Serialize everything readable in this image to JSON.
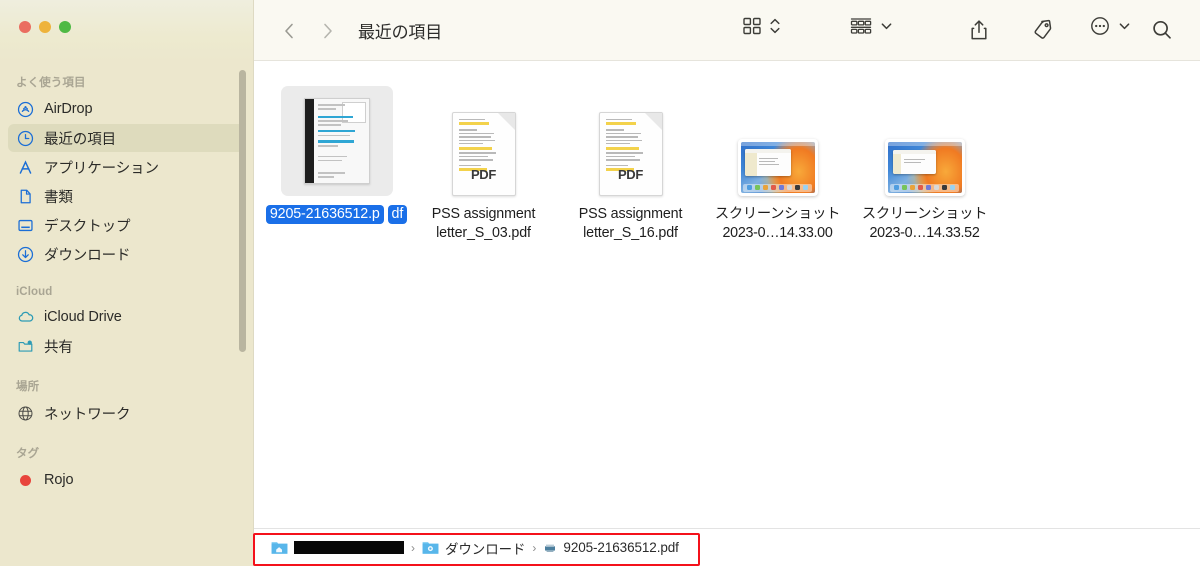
{
  "window": {
    "title": "最近の項目",
    "traffic_lights": [
      "close",
      "minimize",
      "zoom"
    ],
    "colors": {
      "sidebar_bg": "#ece7cd",
      "toolbar_bg": "#faf9f2",
      "selection_blue": "#1a6fe8",
      "annotation_red": "#f4111b",
      "sidebar_selected": "#dedbbd",
      "icon_blue": "#1b6ed6"
    }
  },
  "toolbar": {
    "back_label": "戻る",
    "forward_label": "進む",
    "title": "最近の項目",
    "buttons": [
      {
        "name": "icon-view",
        "label": "アイコン表示",
        "icon": "grid-icon"
      },
      {
        "name": "view-stepper",
        "label": "表示切り替え",
        "icon": "chevron-updown-icon"
      },
      {
        "name": "group-by",
        "label": "グループ分け",
        "icon": "group-rows-icon"
      },
      {
        "name": "group-by-chevron",
        "label": "グループメニュー",
        "icon": "chevron-down-icon"
      },
      {
        "name": "share",
        "label": "共有",
        "icon": "share-icon"
      },
      {
        "name": "tag",
        "label": "タグ",
        "icon": "tag-icon"
      },
      {
        "name": "more",
        "label": "その他",
        "icon": "ellipsis-circle-icon"
      },
      {
        "name": "more-chevron",
        "label": "その他メニュー",
        "icon": "chevron-down-icon"
      },
      {
        "name": "search",
        "label": "検索",
        "icon": "search-icon"
      }
    ]
  },
  "sidebar": {
    "groups": [
      {
        "title": "よく使う項目",
        "items": [
          {
            "label": "AirDrop",
            "icon": "airdrop-icon",
            "selected": false
          },
          {
            "label": "最近の項目",
            "icon": "clock-icon",
            "selected": true
          },
          {
            "label": "アプリケーション",
            "icon": "applications-icon",
            "selected": false
          },
          {
            "label": "書類",
            "icon": "document-icon",
            "selected": false
          },
          {
            "label": "デスクトップ",
            "icon": "desktop-icon",
            "selected": false
          },
          {
            "label": "ダウンロード",
            "icon": "download-icon",
            "selected": false
          }
        ]
      },
      {
        "title": "iCloud",
        "items": [
          {
            "label": "iCloud Drive",
            "icon": "cloud-icon",
            "selected": false
          },
          {
            "label": "共有",
            "icon": "shared-folder-icon",
            "selected": false
          }
        ]
      },
      {
        "title": "場所",
        "items": [
          {
            "label": "ネットワーク",
            "icon": "globe-icon",
            "selected": false
          }
        ]
      },
      {
        "title": "タグ",
        "items": [
          {
            "label": "Rojo",
            "icon": "tag-dot-red",
            "selected": false
          }
        ]
      }
    ]
  },
  "files": [
    {
      "name_lines": [
        "9205-21636512.p",
        "df"
      ],
      "full_name": "9205-21636512.pdf",
      "kind": "pdf-preview",
      "selected": true
    },
    {
      "name_lines": [
        "PSS assignment",
        "letter_S_03.pdf"
      ],
      "full_name": "PSS assignment letter_S_03.pdf",
      "kind": "pdf-icon",
      "badge": "PDF",
      "selected": false
    },
    {
      "name_lines": [
        "PSS assignment",
        "letter_S_16.pdf"
      ],
      "full_name": "PSS assignment letter_S_16.pdf",
      "kind": "pdf-icon",
      "badge": "PDF",
      "selected": false
    },
    {
      "name_lines": [
        "スクリーンショット",
        "2023-0…14.33.00"
      ],
      "full_name": "スクリーンショット 2023-0…14.33.00",
      "kind": "screenshot",
      "selected": false
    },
    {
      "name_lines": [
        "スクリーンショット",
        "2023-0…14.33.52"
      ],
      "full_name": "スクリーンショット 2023-0…14.33.52",
      "kind": "screenshot",
      "selected": false
    }
  ],
  "path_bar": {
    "highlighted": true,
    "crumbs": [
      {
        "label": "",
        "icon": "home-folder-icon",
        "redacted": true
      },
      {
        "label": "ダウンロード",
        "icon": "downloads-folder-icon",
        "redacted": false
      },
      {
        "label": "9205-21636512.pdf",
        "icon": "pdf-file-icon",
        "redacted": false
      }
    ],
    "separator": "›"
  }
}
